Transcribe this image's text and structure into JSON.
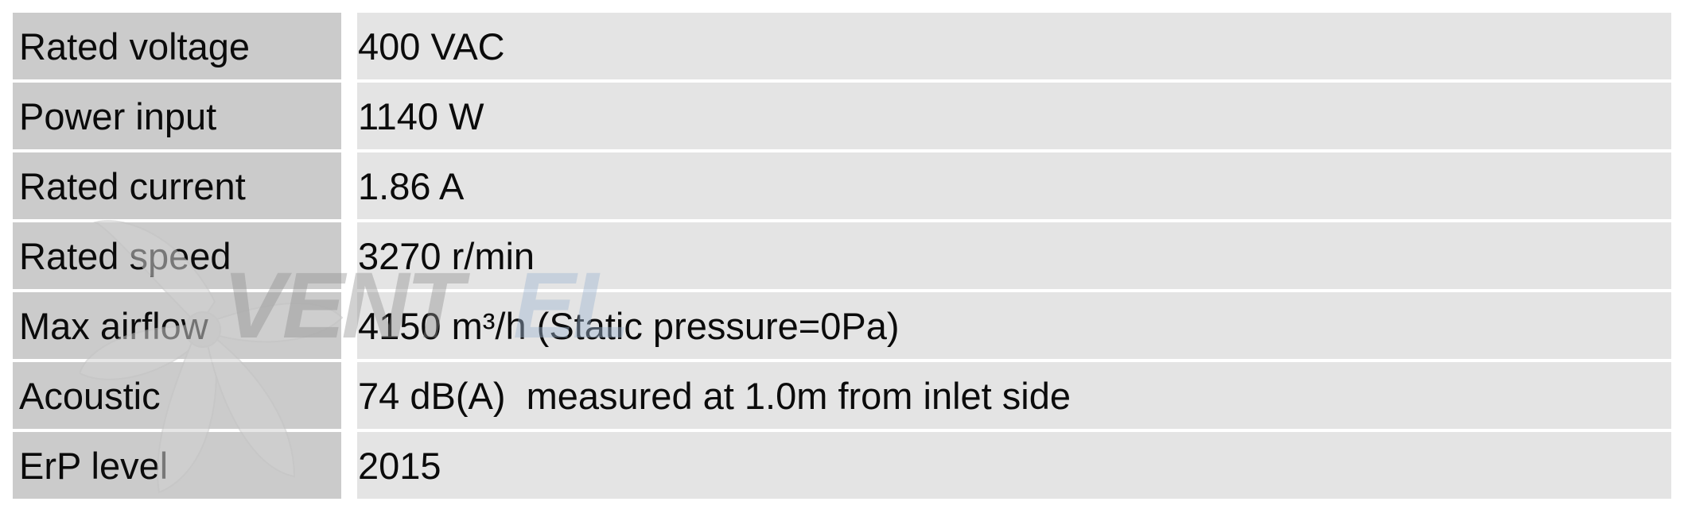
{
  "specs": {
    "rows": [
      {
        "label": "Rated voltage",
        "value": "400 VAC"
      },
      {
        "label": "Power input",
        "value": "1140 W"
      },
      {
        "label": "Rated current",
        "value": "1.86 A"
      },
      {
        "label": "Rated speed",
        "value": "3270 r/min"
      },
      {
        "label": "Max airflow",
        "value": "4150 m³/h (Static pressure=0Pa)"
      },
      {
        "label": "Acoustic",
        "value": "74 dB(A)  measured at 1.0m from inlet side"
      },
      {
        "label": "ErP level",
        "value": "2015"
      }
    ]
  },
  "watermark": {
    "text_main": "VENT",
    "text_accent": "EL",
    "color_main": "#8f8f8f",
    "color_accent": "#9fb6d1"
  },
  "colors": {
    "label_bg": "#cbcbcb",
    "value_bg": "#e4e4e4",
    "text": "#0b0b0b"
  }
}
